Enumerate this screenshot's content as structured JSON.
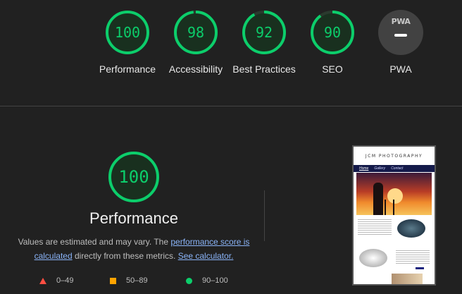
{
  "gauges": [
    {
      "score": "100",
      "label": "Performance",
      "color": "#0cce6b"
    },
    {
      "score": "98",
      "label": "Accessibility",
      "color": "#0cce6b"
    },
    {
      "score": "92",
      "label": "Best Practices",
      "color": "#0cce6b"
    },
    {
      "score": "90",
      "label": "SEO",
      "color": "#0cce6b"
    }
  ],
  "pwa": {
    "badge": "PWA",
    "label": "PWA"
  },
  "performance": {
    "score": "100",
    "title": "Performance",
    "desc_prefix": "Values are estimated and may vary. The ",
    "link_score": "performance score is calculated",
    "desc_middle": " directly from these metrics. ",
    "link_calc": "See calculator."
  },
  "legend": {
    "fail": "0–49",
    "average": "50–89",
    "pass": "90–100"
  },
  "thumbnail": {
    "site_title": "JCM PHOTOGRAPHY",
    "nav": [
      "Home",
      "Gallery",
      "Contact"
    ]
  },
  "colors": {
    "pass": "#0cce6b",
    "average": "#ffa400",
    "fail": "#ff4e42",
    "link": "#8ab4f8"
  }
}
